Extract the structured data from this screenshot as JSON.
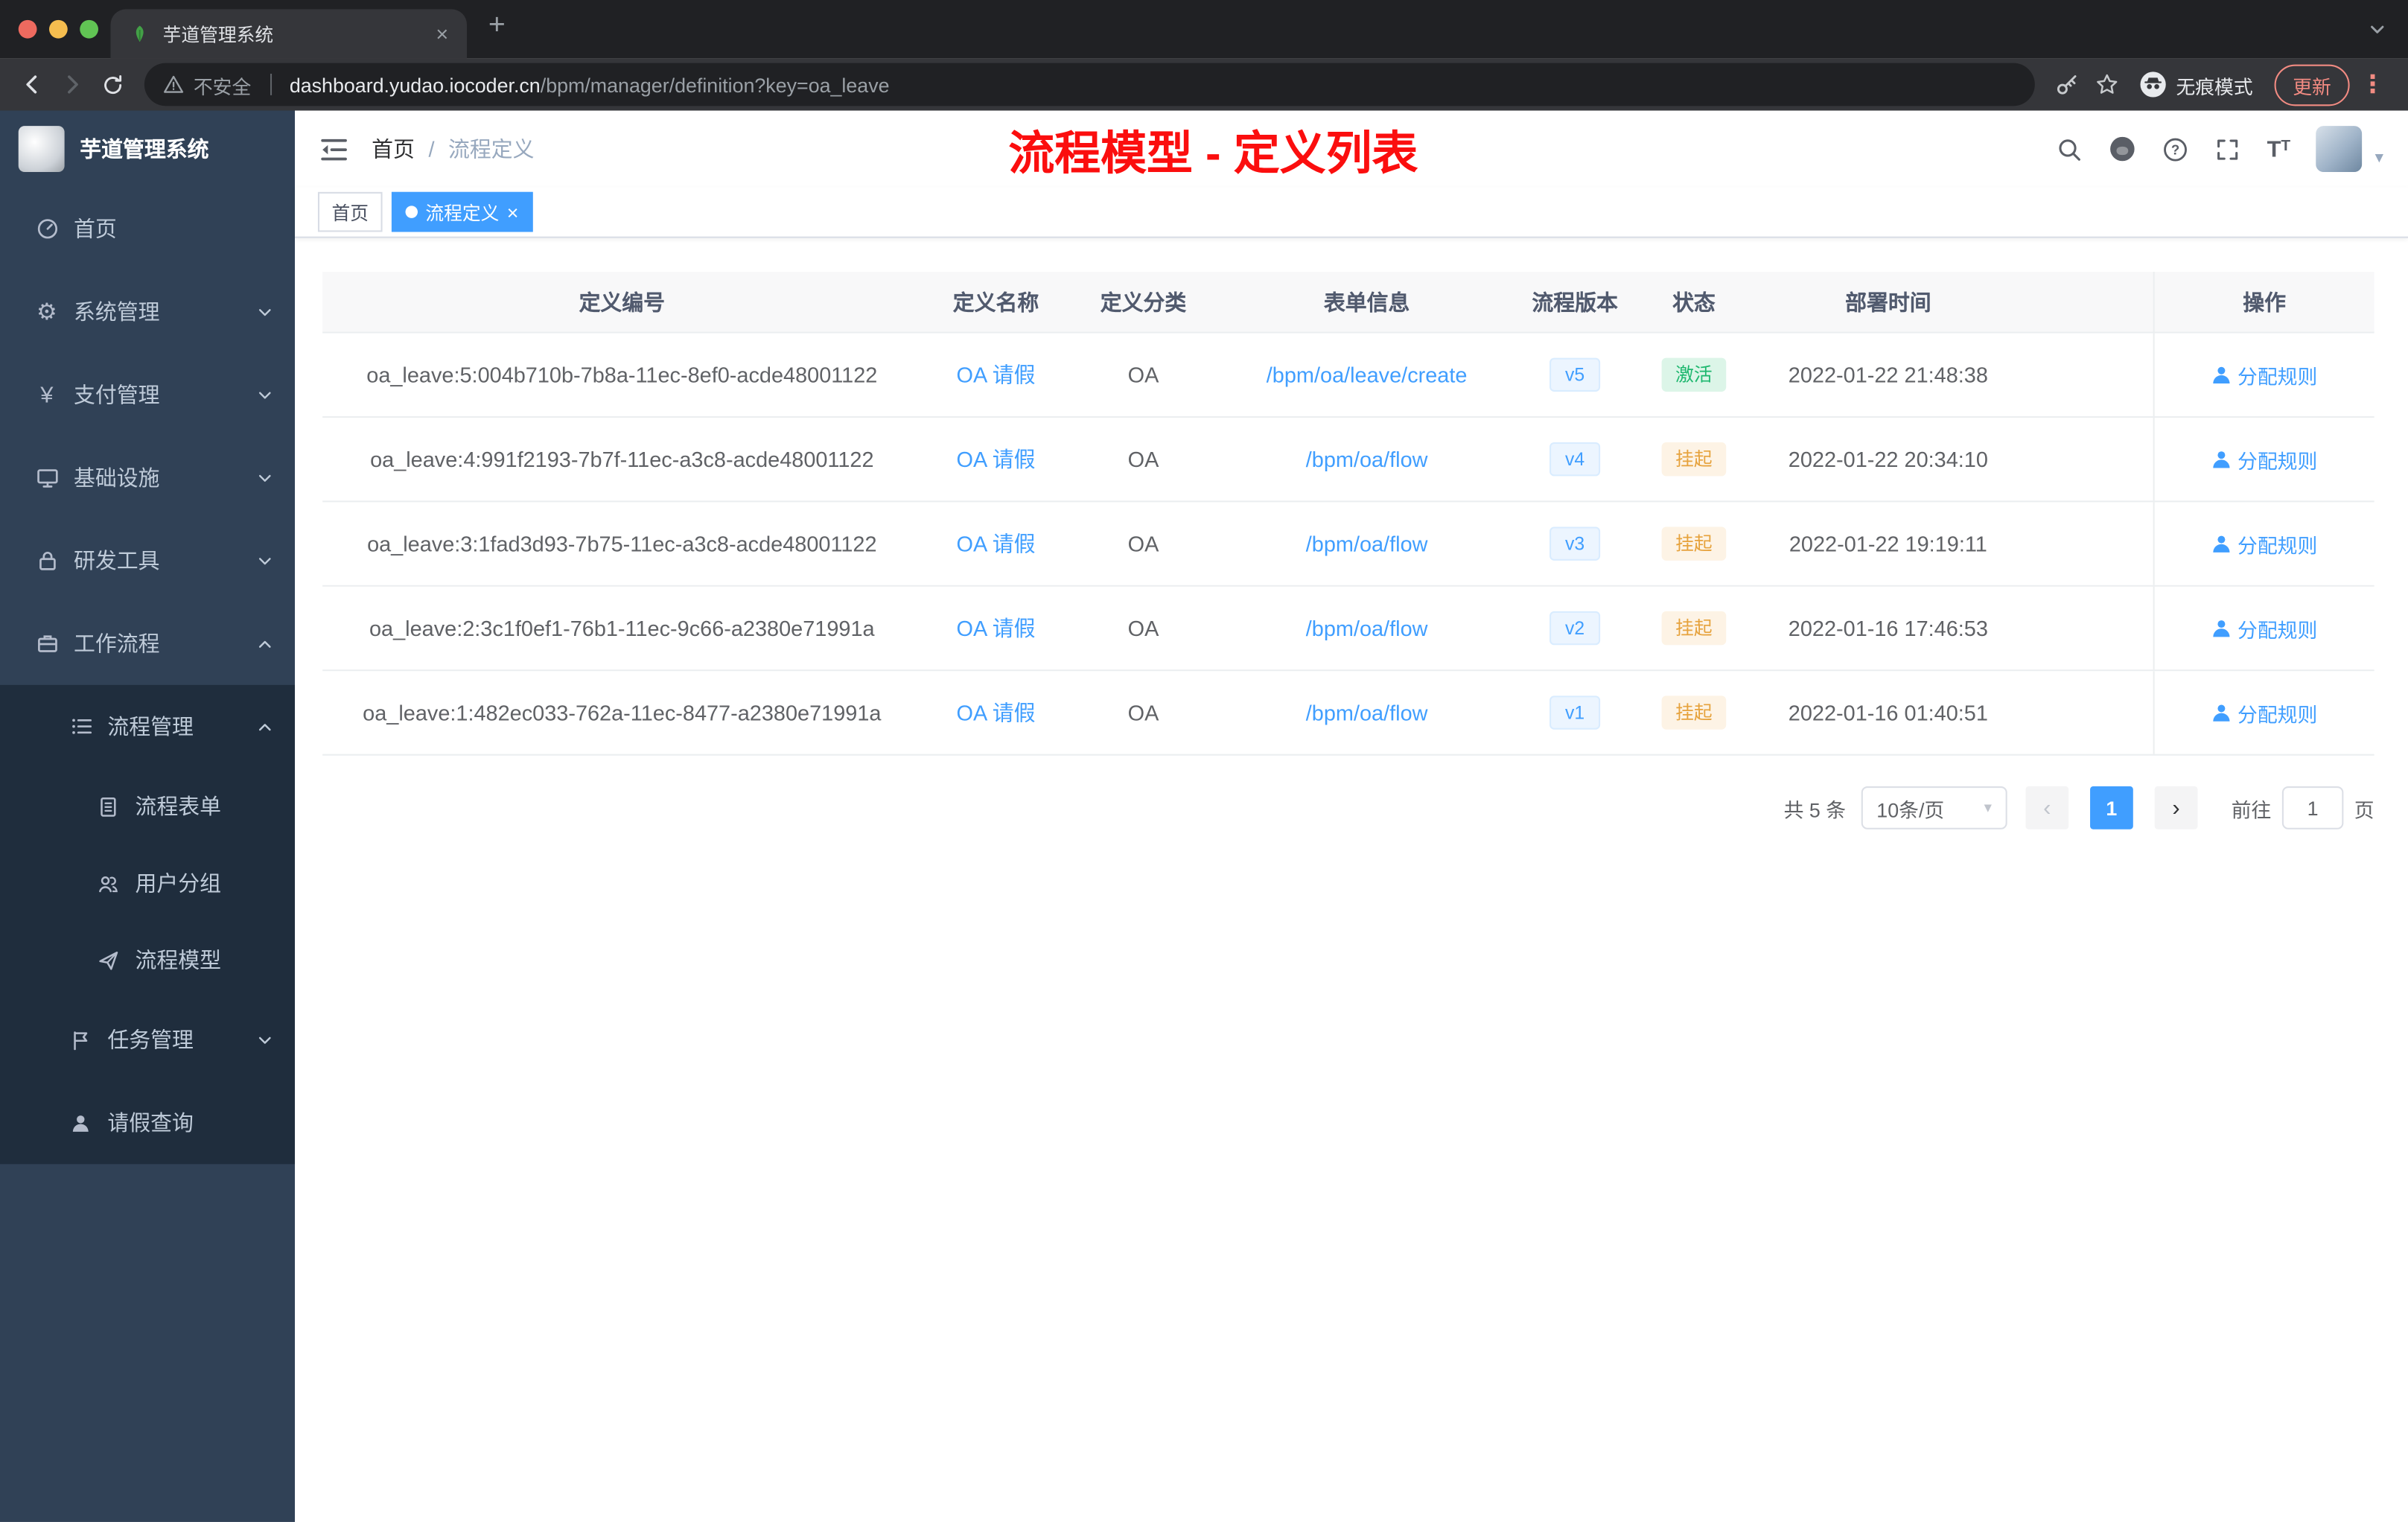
{
  "browser": {
    "tab_title": "芋道管理系统",
    "security_label": "不安全",
    "url_host": "dashboard.yudao.iocoder.cn",
    "url_path": "/bpm/manager/definition?key=oa_leave",
    "incognito_label": "无痕模式",
    "update_label": "更新"
  },
  "icons": {
    "close": "×",
    "plus": "+",
    "caret_down": "▾",
    "prev": "‹",
    "next": "›",
    "dots": "⋮",
    "gear": "⚙",
    "yen": "¥"
  },
  "sidebar": {
    "title": "芋道管理系统",
    "items": [
      {
        "label": "首页"
      },
      {
        "label": "系统管理"
      },
      {
        "label": "支付管理"
      },
      {
        "label": "基础设施"
      },
      {
        "label": "研发工具"
      },
      {
        "label": "工作流程"
      },
      {
        "label": "流程管理"
      },
      {
        "label": "流程表单"
      },
      {
        "label": "用户分组"
      },
      {
        "label": "流程模型"
      },
      {
        "label": "任务管理"
      },
      {
        "label": "请假查询"
      }
    ]
  },
  "header": {
    "breadcrumb_home": "首页",
    "breadcrumb_sep": "/",
    "breadcrumb_current": "流程定义",
    "overlay_title": "流程模型 - 定义列表"
  },
  "tags": {
    "home": "首页",
    "active": "流程定义"
  },
  "table": {
    "columns": [
      "定义编号",
      "定义名称",
      "定义分类",
      "表单信息",
      "流程版本",
      "状态",
      "部署时间",
      "操作"
    ],
    "rows": [
      {
        "id": "oa_leave:5:004b710b-7b8a-11ec-8ef0-acde48001122",
        "name": "OA 请假",
        "category": "OA",
        "form": "/bpm/oa/leave/create",
        "version": "v5",
        "status": "激活",
        "status_type": "active",
        "deploy_time": "2022-01-22 21:48:38",
        "action": "分配规则"
      },
      {
        "id": "oa_leave:4:991f2193-7b7f-11ec-a3c8-acde48001122",
        "name": "OA 请假",
        "category": "OA",
        "form": "/bpm/oa/flow",
        "version": "v4",
        "status": "挂起",
        "status_type": "suspended",
        "deploy_time": "2022-01-22 20:34:10",
        "action": "分配规则"
      },
      {
        "id": "oa_leave:3:1fad3d93-7b75-11ec-a3c8-acde48001122",
        "name": "OA 请假",
        "category": "OA",
        "form": "/bpm/oa/flow",
        "version": "v3",
        "status": "挂起",
        "status_type": "suspended",
        "deploy_time": "2022-01-22 19:19:11",
        "action": "分配规则"
      },
      {
        "id": "oa_leave:2:3c1f0ef1-76b1-11ec-9c66-a2380e71991a",
        "name": "OA 请假",
        "category": "OA",
        "form": "/bpm/oa/flow",
        "version": "v2",
        "status": "挂起",
        "status_type": "suspended",
        "deploy_time": "2022-01-16 17:46:53",
        "action": "分配规则"
      },
      {
        "id": "oa_leave:1:482ec033-762a-11ec-8477-a2380e71991a",
        "name": "OA 请假",
        "category": "OA",
        "form": "/bpm/oa/flow",
        "version": "v1",
        "status": "挂起",
        "status_type": "suspended",
        "deploy_time": "2022-01-16 01:40:51",
        "action": "分配规则"
      }
    ]
  },
  "pagination": {
    "total": "共 5 条",
    "page_size": "10条/页",
    "page": "1",
    "goto_label": "前往",
    "goto_value": "1",
    "unit": "页"
  },
  "colors": {
    "accent": "#409eff",
    "sidebar_bg": "#304156",
    "submenu_bg": "#1f2d3d",
    "title_red": "#fb0e0e",
    "status_active": "#1db76e",
    "status_suspended": "#e6a23c"
  }
}
